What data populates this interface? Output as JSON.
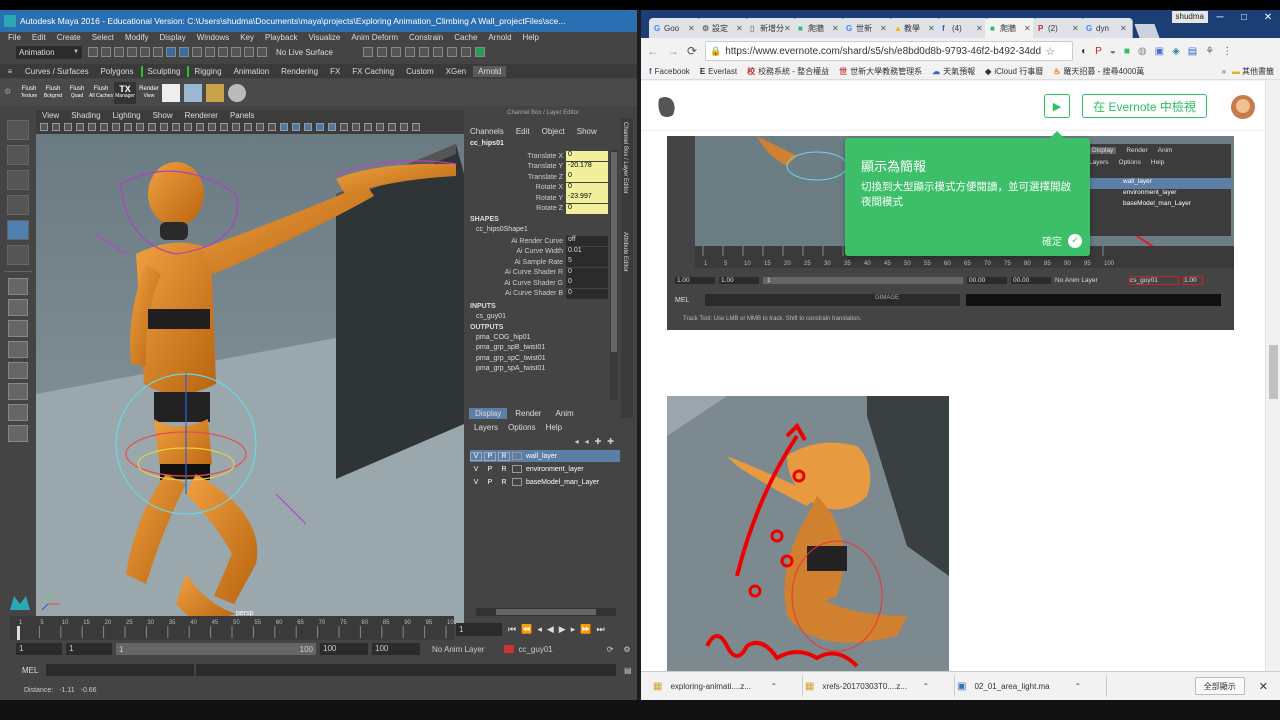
{
  "maya": {
    "title": "Autodesk Maya 2016 - Educational Version: C:\\Users\\shudma\\Documents\\maya\\projects\\Exploring Animation_Climbing A Wall_projectFiles\\sce...",
    "menus": [
      "File",
      "Edit",
      "Create",
      "Select",
      "Modify",
      "Display",
      "Windows",
      "Key",
      "Playback",
      "Visualize",
      "Anim Deform",
      "Constrain",
      "Cache",
      "Arnold",
      "Help"
    ],
    "mode": "Animation",
    "live_surface": "No Live Surface",
    "shelf_tabs": [
      "Curves / Surfaces",
      "Polygons",
      "Sculpting",
      "Rigging",
      "Animation",
      "Rendering",
      "FX",
      "FX Caching",
      "Custom",
      "XGen",
      "Arnold"
    ],
    "active_shelf": "Arnold",
    "shelf_tools": [
      {
        "top": "Flush",
        "bottom": "Texture"
      },
      {
        "top": "Flush",
        "bottom": "Bckgrnd"
      },
      {
        "top": "Flush",
        "bottom": "Quad"
      },
      {
        "top": "Flush",
        "bottom": "All Caches"
      },
      {
        "top": "TX",
        "bottom": "Manager"
      },
      {
        "top": "Render",
        "bottom": "View"
      }
    ],
    "viewport_menus": [
      "View",
      "Shading",
      "Lighting",
      "Show",
      "Renderer",
      "Panels"
    ],
    "camera_label": "persp",
    "channel_box": {
      "header": "Channel Box / Layer Editor",
      "menus": [
        "Channels",
        "Edit",
        "Object",
        "Show"
      ],
      "node": "cc_hips01",
      "attrs": [
        {
          "name": "Translate X",
          "value": "0"
        },
        {
          "name": "Translate Y",
          "value": "-20.178"
        },
        {
          "name": "Translate Z",
          "value": "0"
        },
        {
          "name": "Rotate X",
          "value": "0"
        },
        {
          "name": "Rotate Y",
          "value": "-23.997"
        },
        {
          "name": "Rotate Z",
          "value": "0"
        }
      ],
      "shapes_label": "SHAPES",
      "shape_node": "cc_hips0Shape1",
      "shape_attrs": [
        {
          "name": "Ai Render Curve",
          "value": "off"
        },
        {
          "name": "Ai Curve Width",
          "value": "0.01"
        },
        {
          "name": "Ai Sample Rate",
          "value": "5"
        },
        {
          "name": "Ai Curve Shader R",
          "value": "0"
        },
        {
          "name": "Ai Curve Shader G",
          "value": "0"
        },
        {
          "name": "Ai Curve Shader B",
          "value": "0"
        }
      ],
      "inputs_label": "INPUTS",
      "inputs": [
        "cs_guy01"
      ],
      "outputs_label": "OUTPUTS",
      "outputs": [
        "pma_COG_hip01",
        "pma_grp_spB_twist01",
        "pma_grp_spC_twist01",
        "pma_grp_spA_twist01"
      ]
    },
    "side_tabs": [
      "Channel Box / Layer Editor",
      "Attribute Editor"
    ],
    "layer_editor": {
      "tabs": [
        "Display",
        "Render",
        "Anim"
      ],
      "menus": [
        "Layers",
        "Options",
        "Help"
      ],
      "layers": [
        {
          "v": "V",
          "p": "P",
          "r": "R",
          "name": "wall_layer",
          "selected": true
        },
        {
          "v": "V",
          "p": "P",
          "r": "R",
          "name": "environment_layer",
          "selected": false
        },
        {
          "v": "V",
          "p": "P",
          "r": "R",
          "name": "baseModel_man_Layer",
          "selected": false
        }
      ]
    },
    "timeline": {
      "ticks": [
        "1",
        "5",
        "10",
        "15",
        "20",
        "25",
        "30",
        "35",
        "40",
        "45",
        "50",
        "55",
        "60",
        "65",
        "70",
        "75",
        "80",
        "85",
        "90",
        "95",
        "100"
      ],
      "current_frame": "1",
      "range_start": "1",
      "range_inner_start": "1",
      "range_slider_start": "1",
      "range_slider_end": "100",
      "range_inner_end": "100",
      "range_end": "100",
      "anim_layer": "No Anim Layer",
      "character": "cc_guy01"
    },
    "command_line_label": "MEL",
    "help_line": {
      "label": "Distance:",
      "v1": "-1.11",
      "v2": "-0.66"
    }
  },
  "chrome": {
    "tabs": [
      {
        "icon": "google-icon",
        "glyph": "G",
        "color": "#4285f4",
        "label": "Goo"
      },
      {
        "icon": "gear-icon",
        "glyph": "⚙",
        "color": "#666",
        "label": "設定"
      },
      {
        "icon": "page-icon",
        "glyph": "▯",
        "color": "#888",
        "label": "新增分頁"
      },
      {
        "icon": "evernote-icon",
        "glyph": "■",
        "color": "#2dbe60",
        "label": "爬牆"
      },
      {
        "icon": "google-icon",
        "glyph": "G",
        "color": "#4285f4",
        "label": "世新"
      },
      {
        "icon": "drive-icon",
        "glyph": "▲",
        "color": "#f4b400",
        "label": "教學"
      },
      {
        "icon": "facebook-icon",
        "glyph": "f",
        "color": "#3b5998",
        "label": "(4)"
      },
      {
        "icon": "evernote-icon",
        "glyph": "■",
        "color": "#2dbe60",
        "label": "爬牆"
      },
      {
        "icon": "pinterest-icon",
        "glyph": "P",
        "color": "#cb2027",
        "label": "(2)"
      },
      {
        "icon": "google-icon",
        "glyph": "G",
        "color": "#4285f4",
        "label": "dyn"
      }
    ],
    "active_tab": 7,
    "user_name": "shudma",
    "url": "https://www.evernote.com/shard/s5/sh/e8bd0d8b-9793-46f2-b492-34dd",
    "bookmarks": [
      {
        "icon": "facebook-icon",
        "glyph": "f",
        "color": "#3b5998",
        "label": "Facebook"
      },
      {
        "icon": "everlast-icon",
        "glyph": "E",
        "color": "#222",
        "label": "Everlast"
      },
      {
        "icon": "school-icon",
        "glyph": "校",
        "color": "#b33",
        "label": "校務系統 - 整合權益"
      },
      {
        "icon": "university-icon",
        "glyph": "世",
        "color": "#c33",
        "label": "世新大學教務管理系"
      },
      {
        "icon": "weather-icon",
        "glyph": "☁",
        "color": "#36c",
        "label": "天氣預報"
      },
      {
        "icon": "apple-icon",
        "glyph": "◆",
        "color": "#333",
        "label": "iCloud 行事曆"
      },
      {
        "icon": "recruit-icon",
        "glyph": "♨",
        "color": "#e60",
        "label": "羅天招募 - 搜尋4000萬"
      }
    ],
    "other_bookmarks": "其他書籤",
    "evernote_button": "在 Evernote 中檢視",
    "tooltip": {
      "title": "顯示為簡報",
      "body": "切換到大型顯示模式方便閱讀，並可選擇開啟夜間模式",
      "ok": "確定"
    },
    "shot": {
      "layer_tabs": [
        "Display",
        "Render",
        "Anim"
      ],
      "layer_menus": [
        "Layers",
        "Options",
        "Help"
      ],
      "layers": [
        "wall_layer",
        "environment_layer",
        "baseModel_man_Layer"
      ],
      "range_start": "1.00",
      "range_inner": "1.00",
      "range_mid": "1",
      "range_end": "1.00",
      "time_a": "00.00",
      "time_b": "00.00",
      "anim_layer": "No Anim Layer",
      "character": "cs_guy01",
      "mel": "MEL",
      "ticks": [
        "1",
        "5",
        "10",
        "15",
        "20",
        "25",
        "30",
        "35",
        "40",
        "45",
        "50",
        "55",
        "60",
        "65",
        "70",
        "75",
        "80",
        "85",
        "90",
        "95",
        "100"
      ],
      "help": "Track Tool: Use LMB or MMB to track. Shift to constrain translation.",
      "tag": "GIMAGE"
    },
    "downloads": [
      {
        "name": "exploring-animati....z..."
      },
      {
        "name": "xrefs-20170303T0....z..."
      },
      {
        "name": "02_01_area_light.ma"
      }
    ],
    "show_all": "全部顯示"
  }
}
